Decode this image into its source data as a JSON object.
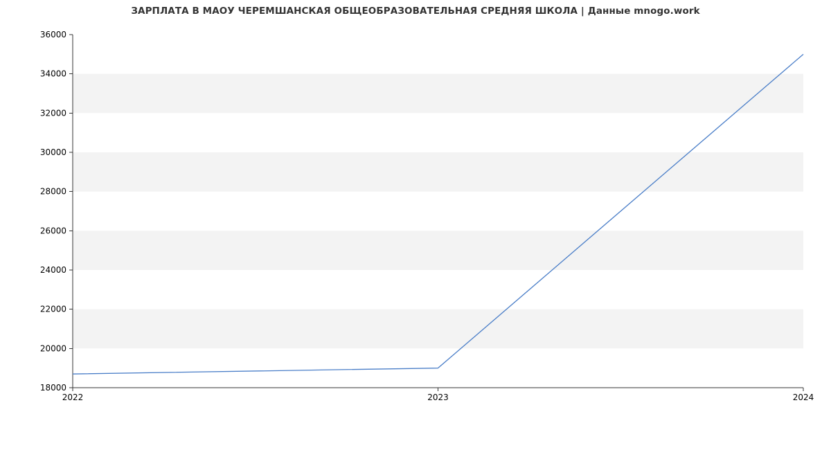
{
  "chart_data": {
    "type": "line",
    "title": "ЗАРПЛАТА В МАОУ ЧЕРЕМШАНСКАЯ ОБЩЕОБРАЗОВАТЕЛЬНАЯ СРЕДНЯЯ ШКОЛА | Данные mnogo.work",
    "x": [
      2022,
      2023,
      2024
    ],
    "values": [
      18700,
      19000,
      35000
    ],
    "xlabel": "",
    "ylabel": "",
    "xticks": [
      2022,
      2023,
      2024
    ],
    "yticks": [
      18000,
      20000,
      22000,
      24000,
      26000,
      28000,
      30000,
      32000,
      34000,
      36000
    ],
    "ylim": [
      18000,
      36000
    ],
    "xlim": [
      2022,
      2024
    ],
    "line_color": "#4a7ec8",
    "band_color": "#f3f3f3"
  }
}
